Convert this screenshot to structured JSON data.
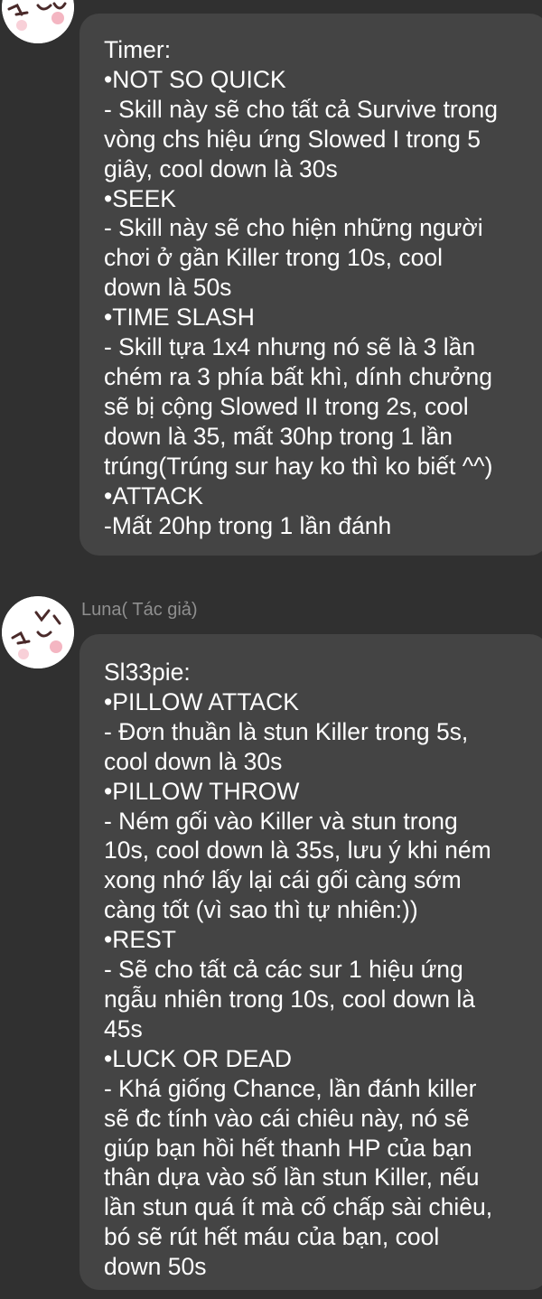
{
  "messages": [
    {
      "author": "",
      "lines": [
        "Timer:",
        "•NOT SO QUICK",
        "- Skill này sẽ cho tất cả Survive trong",
        "vòng chs hiệu ứng Slowed I trong 5",
        "giây, cool down là 30s",
        "•SEEK",
        "- Skill này sẽ cho hiện những người",
        "chơi ở gần Killer trong 10s, cool",
        "down là 50s",
        "•TIME SLASH",
        "- Skill tựa 1x4 nhưng nó sẽ là 3 lần",
        "chém ra 3 phía bất khì, dính chưởng",
        "sẽ bị cộng Slowed II trong 2s, cool",
        "down là 35, mất 30hp trong 1 lần",
        "trúng(Trúng sur hay ko thì ko biết ^^)",
        "•ATTACK",
        "-Mất 20hp trong 1 lần đánh"
      ]
    },
    {
      "author": "Luna( Tác giả)",
      "lines": [
        "Sl33pie:",
        "•PILLOW ATTACK",
        "- Đơn thuần là stun Killer trong 5s,",
        "cool down là 30s",
        "•PILLOW THROW",
        "- Ném gối vào Killer và stun trong",
        "10s, cool down là 35s, lưu ý khi ném",
        "xong nhớ lấy lại cái gối càng sớm",
        "càng tốt (vì sao thì tự nhiên:))",
        "•REST",
        "- Sẽ cho tất cả các sur 1 hiệu ứng",
        "ngẫu nhiên trong 10s, cool down là",
        "45s",
        "•LUCK OR DEAD",
        "- Khá giống Chance, lần đánh killer",
        "sẽ đc tính vào cái chiêu này, nó sẽ",
        "giúp bạn hồi hết thanh HP của bạn",
        "thân dựa vào số lần stun Killer, nếu",
        "lần stun quá ít mà cố chấp sài chiêu,",
        "bó sẽ rút hết máu của bạn, cool",
        "down 50s"
      ]
    }
  ],
  "status_bar": {
    "icons": [
      "clipboard-icon",
      "pencil-icon",
      "mute-icon",
      "wifi-icon",
      "signal-icon"
    ]
  },
  "colors": {
    "background": "#303030",
    "bubble": "#444444",
    "text": "#ffffff",
    "author": "#8f8f8f"
  }
}
